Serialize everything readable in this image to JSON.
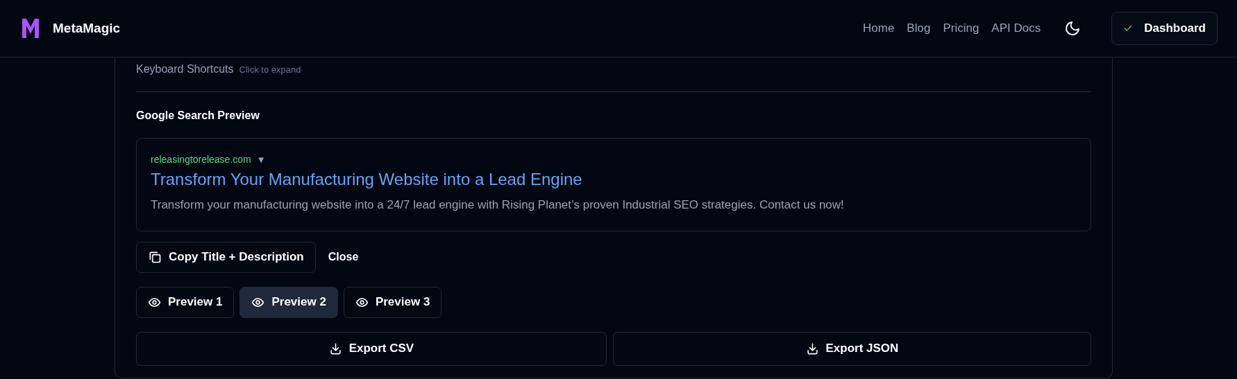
{
  "header": {
    "brand": "MetaMagic",
    "nav": [
      {
        "label": "Home"
      },
      {
        "label": "Blog"
      },
      {
        "label": "Pricing"
      },
      {
        "label": "API Docs"
      }
    ],
    "dashboard_button": "Dashboard"
  },
  "shortcuts": {
    "title": "Keyboard Shortcuts",
    "hint": "Click to expand"
  },
  "preview_section": {
    "heading": "Google Search Preview",
    "url": "releasingtorelease.com",
    "url_caret": "▼",
    "title": "Transform Your Manufacturing Website into a Lead Engine",
    "description": "Transform your manufacturing website into a 24/7 lead engine with Rising Planet’s proven Industrial SEO strategies. Contact us now!"
  },
  "actions": {
    "copy": "Copy Title + Description",
    "close": "Close"
  },
  "preview_tabs": [
    {
      "label": "Preview 1",
      "selected": false
    },
    {
      "label": "Preview 2",
      "selected": true
    },
    {
      "label": "Preview 3",
      "selected": false
    }
  ],
  "exports": [
    {
      "label": "Export CSV"
    },
    {
      "label": "Export JSON"
    }
  ]
}
